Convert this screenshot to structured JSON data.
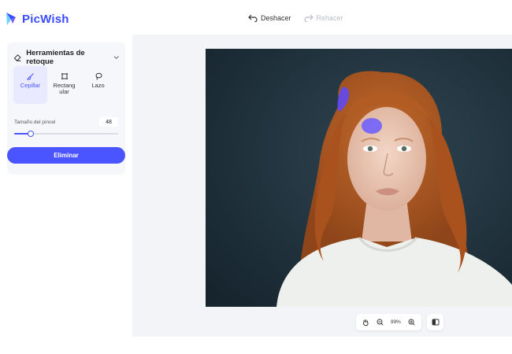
{
  "app": {
    "name": "PicWish",
    "brand_color": "#3b4bff"
  },
  "header": {
    "undo_label": "Deshacer",
    "redo_label": "Rehacer"
  },
  "sidebar": {
    "panel_title": "Herramientas de retoque",
    "tools": [
      {
        "label": "Cepillar",
        "icon": "brush-icon",
        "active": true
      },
      {
        "label": "Rectang ular",
        "icon": "rectangle-select-icon",
        "active": false
      },
      {
        "label": "Lazo",
        "icon": "lasso-icon",
        "active": false
      }
    ],
    "brush_size_label": "Tamaño del pincel",
    "brush_size_value": "48",
    "brush_slider_fraction": 0.16,
    "remove_button_label": "Eliminar",
    "accent": "#4a55ff"
  },
  "zoom": {
    "level": "99%"
  }
}
